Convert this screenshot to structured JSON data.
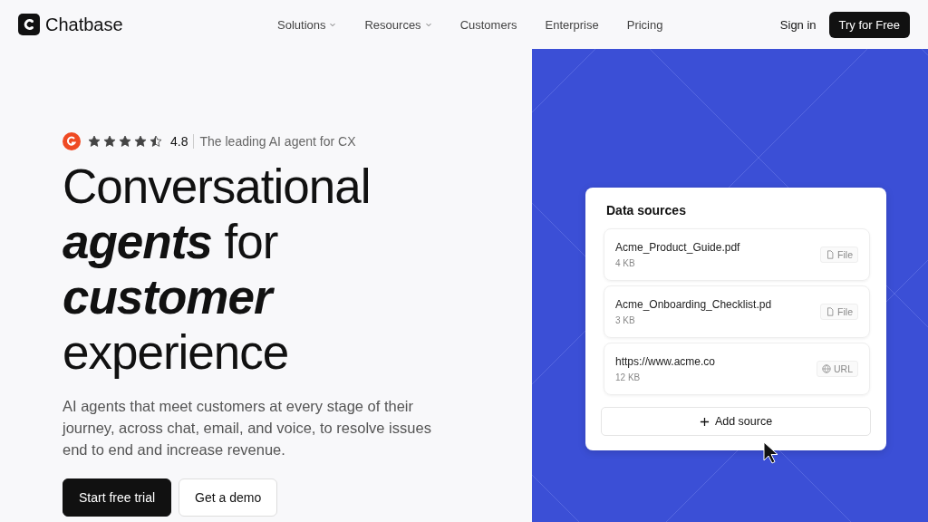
{
  "nav": {
    "brand": "Chatbase",
    "links": [
      {
        "label": "Solutions",
        "dropdown": true
      },
      {
        "label": "Resources",
        "dropdown": true
      },
      {
        "label": "Customers",
        "dropdown": false
      },
      {
        "label": "Enterprise",
        "dropdown": false
      },
      {
        "label": "Pricing",
        "dropdown": false
      }
    ],
    "sign_in": "Sign in",
    "cta": "Try for Free"
  },
  "rating": {
    "stars": 4.5,
    "score": "4.8",
    "tagline": "The leading AI agent for CX"
  },
  "headline": [
    [
      {
        "text": "Conversational",
        "emphasis": false
      }
    ],
    [
      {
        "text": "agents",
        "emphasis": true
      },
      {
        "text": " for",
        "emphasis": false
      }
    ],
    [
      {
        "text": "customer",
        "emphasis": true
      }
    ],
    [
      {
        "text": "experience",
        "emphasis": false
      }
    ]
  ],
  "description": "AI agents that meet customers at every stage of their journey, across chat, email, and voice, to resolve issues end to end and increase revenue.",
  "buttons": [
    {
      "label": "Start free trial",
      "kind": "primary"
    },
    {
      "label": "Get a demo",
      "kind": "secondary"
    }
  ],
  "card": {
    "title": "Data sources",
    "sources": [
      {
        "name": "Acme_Product_Guide.pdf",
        "size": "4 KB",
        "kind": "file",
        "tag": "File"
      },
      {
        "name": "Acme_Onboarding_Checklist.pd",
        "size": "3 KB",
        "kind": "file",
        "tag": "File"
      },
      {
        "name": "https://www.acme.co",
        "size": "12 KB",
        "kind": "url",
        "tag": "URL"
      }
    ],
    "add_button": "Add source"
  }
}
